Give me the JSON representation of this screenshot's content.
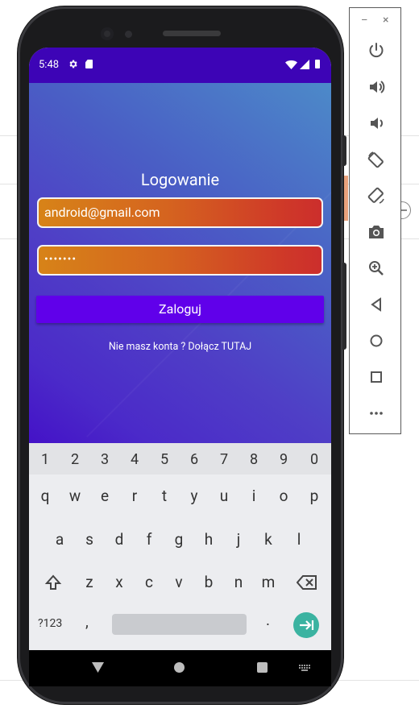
{
  "status_bar": {
    "time": "5:48",
    "icons": [
      "gear-icon",
      "sd-card-icon",
      "wifi-icon",
      "signal-icon",
      "battery-icon"
    ]
  },
  "app": {
    "title": "Logowanie",
    "email_value": "android@gmail.com",
    "password_value": "•••••••",
    "login_label": "Zaloguj",
    "signup_text": "Nie masz konta ? Dołącz TUTAJ",
    "colors": {
      "status_bar": "#3d04b6",
      "button": "#6000ea",
      "field_start": "#d78318",
      "field_end": "#cc2e2c"
    }
  },
  "keyboard": {
    "numbers": [
      "1",
      "2",
      "3",
      "4",
      "5",
      "6",
      "7",
      "8",
      "9",
      "0"
    ],
    "row1": [
      "q",
      "w",
      "e",
      "r",
      "t",
      "y",
      "u",
      "i",
      "o",
      "p"
    ],
    "row2": [
      "a",
      "s",
      "d",
      "f",
      "g",
      "h",
      "j",
      "k",
      "l"
    ],
    "row3": [
      "z",
      "x",
      "c",
      "v",
      "b",
      "n",
      "m"
    ],
    "symbols_label": "?123",
    "comma": ",",
    "period": ".",
    "enter_color": "#3bb3a1"
  },
  "nav_bar": {
    "buttons": [
      "back-icon",
      "home-icon",
      "recents-icon",
      "keyboard-switch-icon"
    ]
  },
  "emulator_toolbar": {
    "minimize": "–",
    "close": "×",
    "buttons": [
      "power-icon",
      "volume-up-icon",
      "volume-down-icon",
      "rotate-left-icon",
      "rotate-right-icon",
      "camera-icon",
      "zoom-icon",
      "back-icon",
      "home-icon",
      "overview-icon",
      "more-icon"
    ]
  }
}
